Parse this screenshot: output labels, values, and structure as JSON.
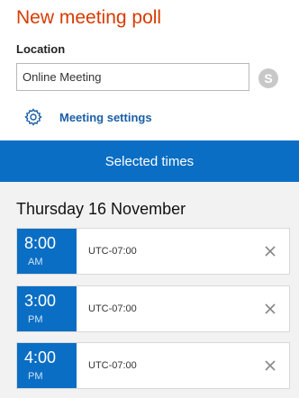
{
  "header": {
    "title": "New meeting poll"
  },
  "location": {
    "label": "Location",
    "value": "Online Meeting",
    "skype_icon": "skype-icon"
  },
  "settings": {
    "icon": "gear-icon",
    "link_label": "Meeting settings"
  },
  "tab": {
    "label": "Selected times"
  },
  "date_heading": "Thursday 16 November",
  "slots": [
    {
      "time": "8:00",
      "ampm": "AM",
      "tz": "UTC-07:00"
    },
    {
      "time": "3:00",
      "ampm": "PM",
      "tz": "UTC-07:00"
    },
    {
      "time": "4:00",
      "ampm": "PM",
      "tz": "UTC-07:00"
    }
  ],
  "colors": {
    "title_accent": "#d83b01",
    "primary_blue": "#0a6ec4",
    "link_blue": "#1a5ea8"
  }
}
